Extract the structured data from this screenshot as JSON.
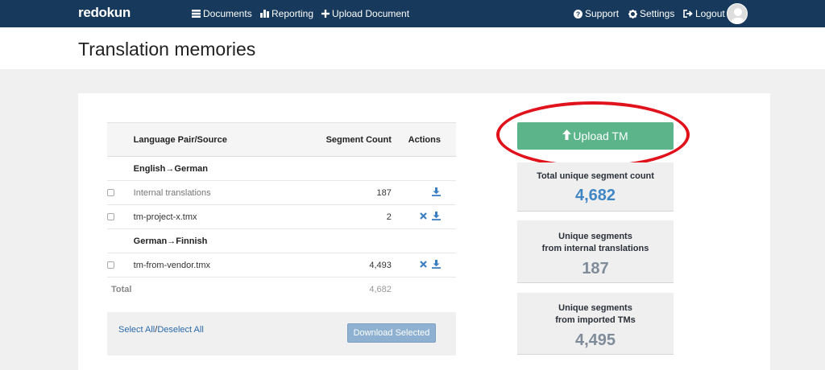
{
  "nav": {
    "brand": "redokun",
    "documents": "Documents",
    "reporting": "Reporting",
    "upload": "Upload Document",
    "support": "Support",
    "settings": "Settings",
    "logout": "Logout"
  },
  "page": {
    "title": "Translation memories"
  },
  "table": {
    "headers": {
      "source": "Language Pair/Source",
      "count": "Segment Count",
      "actions": "Actions"
    },
    "groups": [
      {
        "label": "English→German",
        "rows": [
          {
            "name": "Internal translations",
            "count": "187",
            "icons": [
              "download-icon"
            ]
          },
          {
            "name": "tm-project-x.tmx",
            "count": "2",
            "icons": [
              "delete-icon",
              "download-icon"
            ]
          }
        ]
      },
      {
        "label": "German→Finnish",
        "rows": [
          {
            "name": "tm-from-vendor.tmx",
            "count": "4,493",
            "icons": [
              "delete-icon",
              "download-icon"
            ]
          }
        ]
      }
    ],
    "total_label": "Total",
    "total_count": "4,682"
  },
  "footer": {
    "select_all": "Select All",
    "separator": "/",
    "deselect_all": "Deselect All",
    "download_selected": "Download Selected"
  },
  "upload_tm": "Upload TM",
  "stats": [
    {
      "label_line1": "Total unique segment count",
      "label_line2": "",
      "value": "4,682"
    },
    {
      "label_line1": "Unique segments",
      "label_line2": "from internal translations",
      "value": "187"
    },
    {
      "label_line1": "Unique segments",
      "label_line2": "from imported TMs",
      "value": "4,495"
    }
  ],
  "colors": {
    "navbar": "#173a5c",
    "upload_button": "#5bb48a",
    "highlight_oval": "#e0121b",
    "link": "#2c6aa8",
    "total_value": "#3f86c4"
  }
}
